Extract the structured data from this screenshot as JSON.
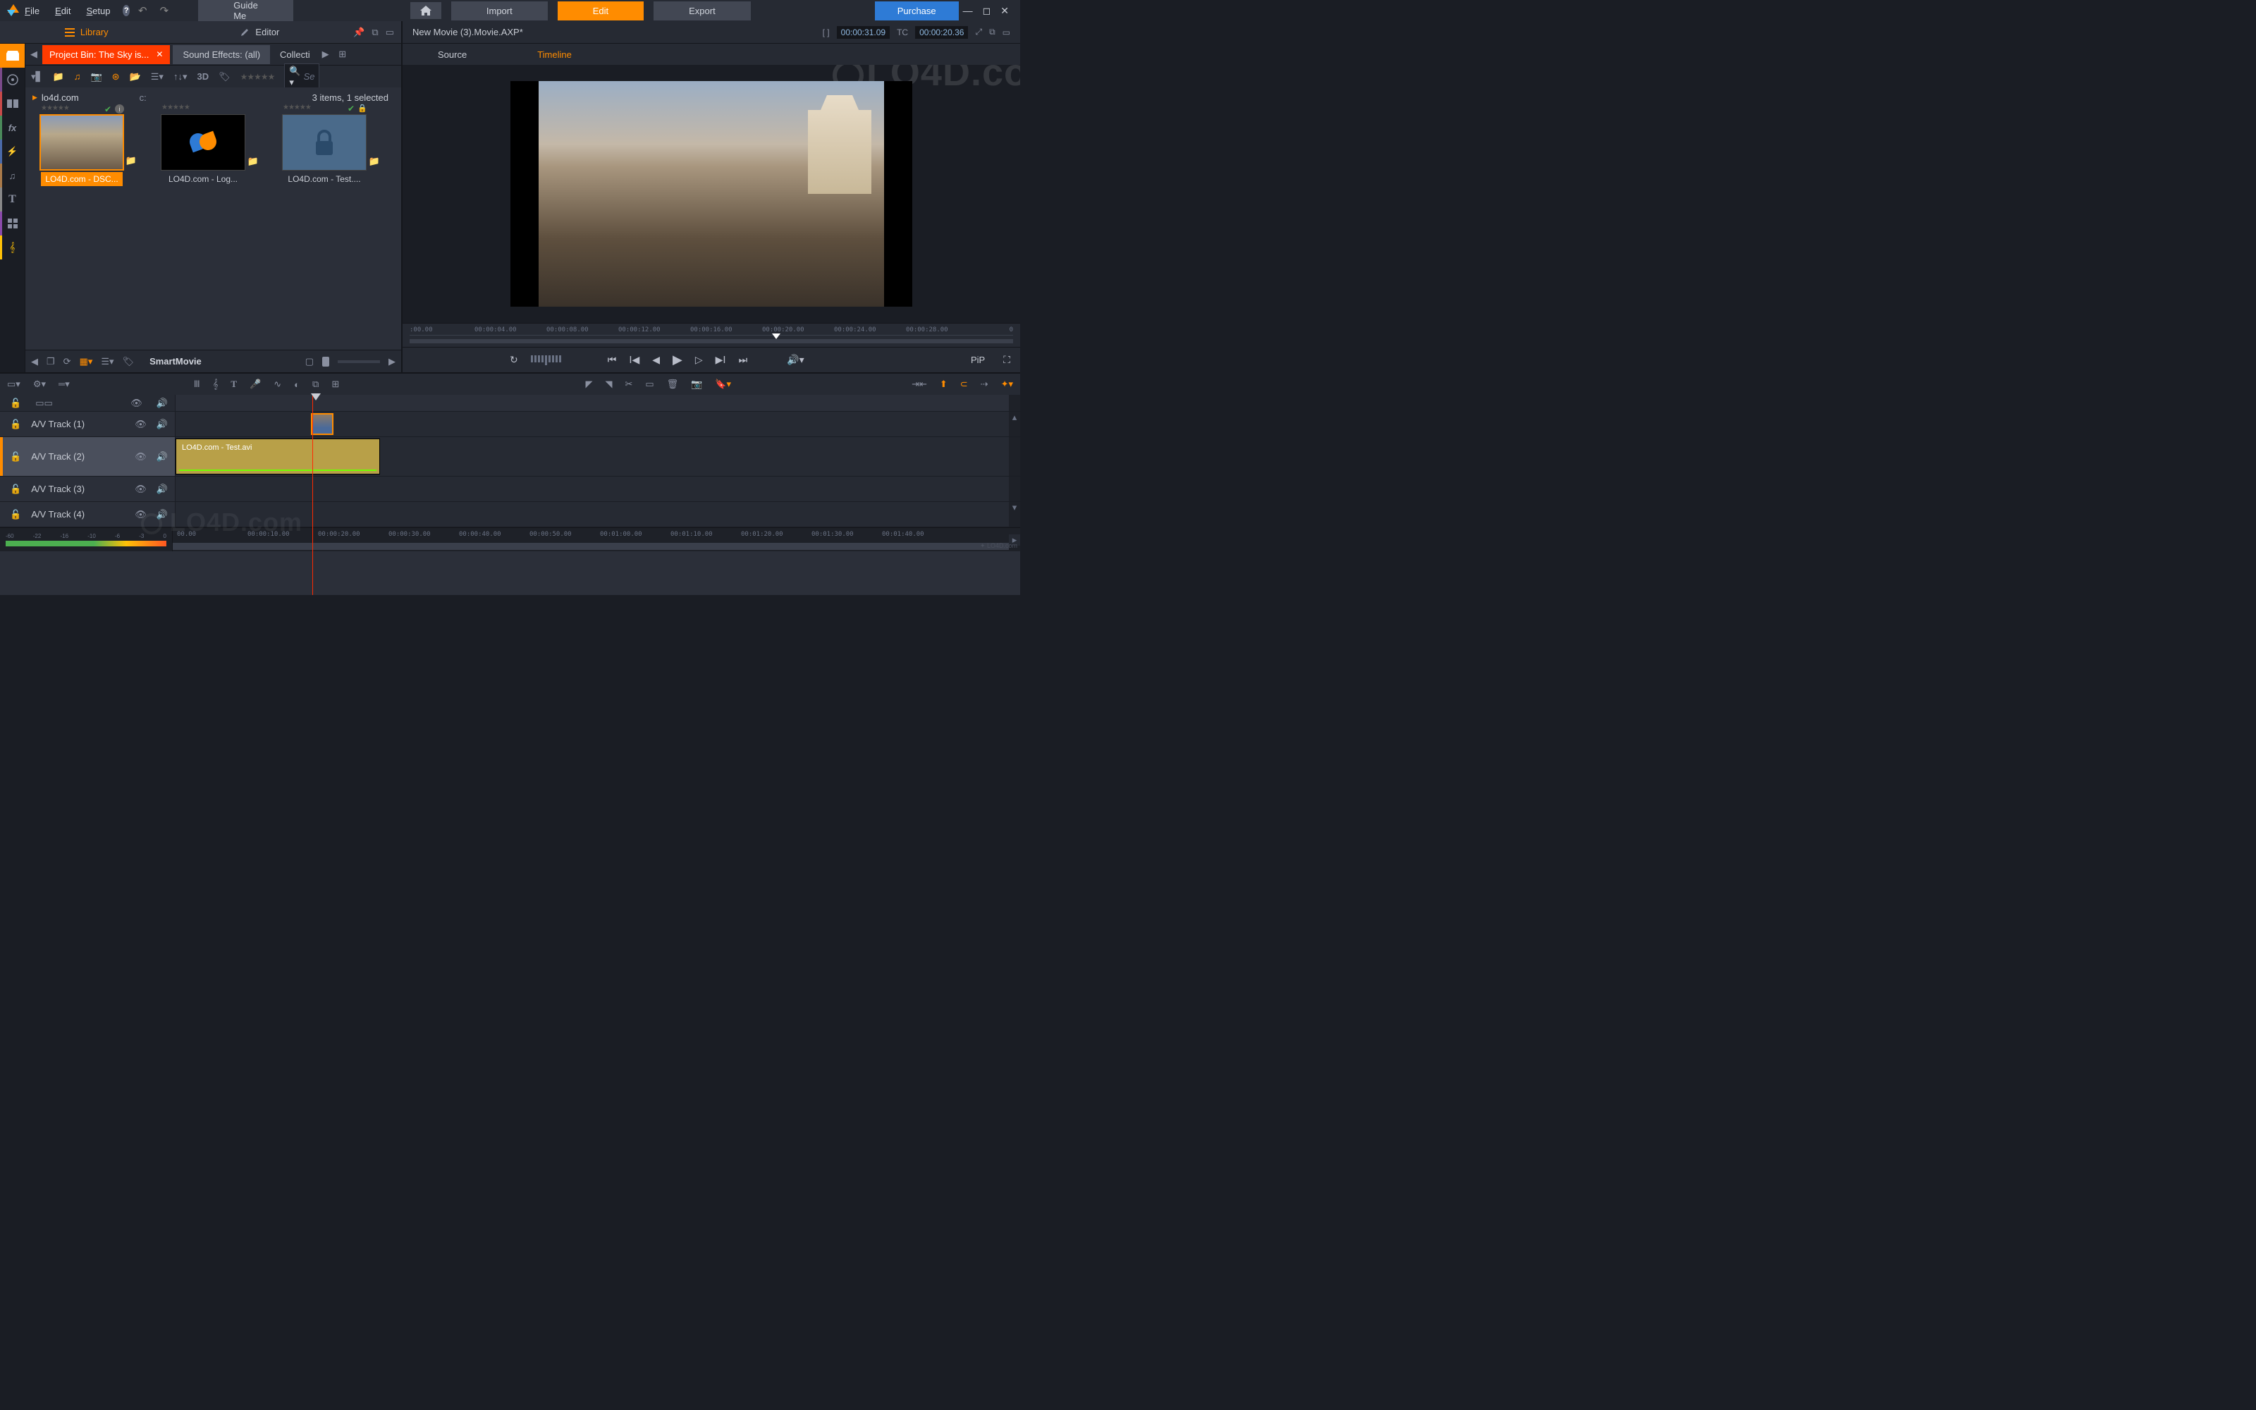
{
  "menu": {
    "file": "File",
    "edit": "Edit",
    "setup": "Setup",
    "guide": "Guide Me",
    "import": "Import",
    "edit_tab": "Edit",
    "export": "Export",
    "purchase": "Purchase"
  },
  "library": {
    "tab_library": "Library",
    "tab_editor": "Editor",
    "project_tab": "Project Bin: The Sky is...",
    "sound_tab": "Sound Effects: (all)",
    "collect_tab": "Collecti",
    "search_placeholder": "Se",
    "td_label": "3D",
    "breadcrumb": "lo4d.com",
    "drive": "c:",
    "count": "3 items, 1 selected",
    "thumbs": [
      {
        "label": "LO4D.com - DSC..."
      },
      {
        "label": "LO4D.com - Log..."
      },
      {
        "label": "LO4D.com - Test...."
      }
    ],
    "smartmovie": "SmartMovie"
  },
  "preview": {
    "movie_name": "New Movie (3).Movie.AXP*",
    "tc1_label": "[ ]",
    "tc1": "00:00:31.09",
    "tc2_label": "TC",
    "tc2": "00:00:20.36",
    "tab_source": "Source",
    "tab_timeline": "Timeline",
    "ruler": [
      ":00.00",
      "00:00:04.00",
      "00:00:08.00",
      "00:00:12.00",
      "00:00:16.00",
      "00:00:20.00",
      "00:00:24.00",
      "00:00:28.00",
      "0"
    ],
    "pip": "PiP"
  },
  "timeline": {
    "tracks": [
      {
        "name": "A/V Track (1)"
      },
      {
        "name": "A/V Track (2)"
      },
      {
        "name": "A/V Track (3)"
      },
      {
        "name": "A/V Track (4)"
      }
    ],
    "clip2_label": "LO4D.com - Test.avi",
    "ruler": [
      "00.00",
      "00:00:10.00",
      "00:00:20.00",
      "00:00:30.00",
      "00:00:40.00",
      "00:00:50.00",
      "00:01:00.00",
      "00:01:10.00",
      "00:01:20.00",
      "00:01:30.00",
      "00:01:40.00"
    ],
    "meter": [
      "-60",
      "-22",
      "-16",
      "-10",
      "-6",
      "-3",
      "0"
    ]
  },
  "watermark": "LO4D.com",
  "footer_tag": "✦ LO4D.com"
}
